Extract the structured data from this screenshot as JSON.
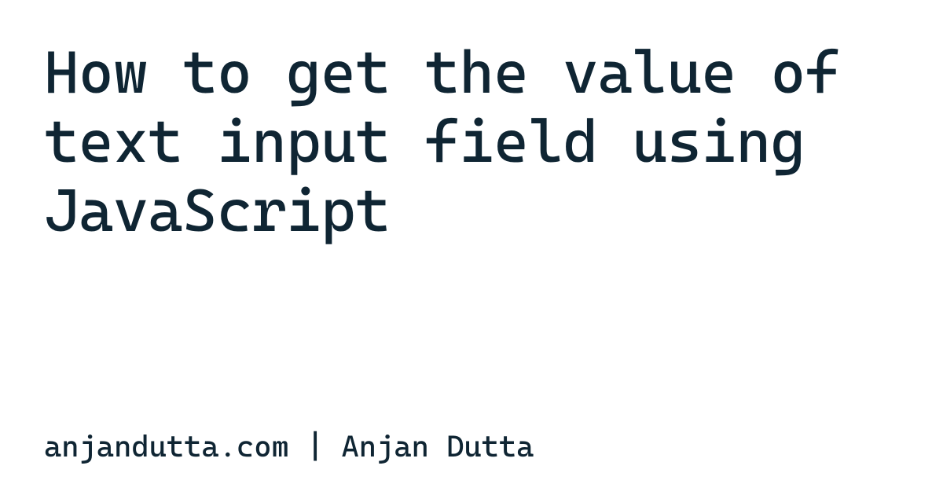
{
  "title": "How to get the value of text input field using JavaScript",
  "byline": "anjandutta.com | Anjan Dutta"
}
